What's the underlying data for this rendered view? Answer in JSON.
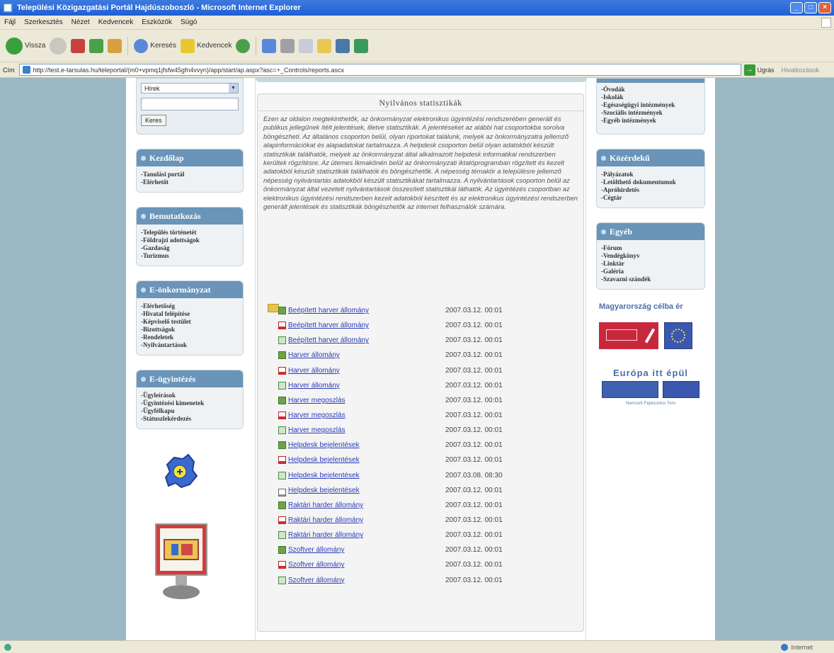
{
  "window": {
    "title": "Települési Közigazgatási Portál Hajdúszoboszló - Microsoft Internet Explorer",
    "btn_min": "_",
    "btn_max": "□",
    "btn_close": "×"
  },
  "menubar": {
    "items": [
      "Fájl",
      "Szerkesztés",
      "Nézet",
      "Kedvencek",
      "Eszközök",
      "Súgó"
    ]
  },
  "toolbar": {
    "back": "Vissza",
    "search": "Keresés",
    "favorites": "Kedvencek"
  },
  "address": {
    "label": "Cím",
    "url": "http://test.e-tarsulas.hu/teleportal/(m0+vpmq1jfsfw45gfn4vvyn)/app/start/ap.aspx?asc=+_Controls/reports.ascx",
    "go": "Ugrás",
    "links": "Hivatkozások"
  },
  "left": {
    "search": {
      "select_value": "Hírek",
      "button": "Keres"
    },
    "menus": [
      {
        "title": "Kezdőlap",
        "items": [
          "-Tanulási portál",
          "-Elérhetőt"
        ]
      },
      {
        "title": "Bemutatkozás",
        "items": [
          "-Település történetét",
          "-Földrajzi adottságok",
          "-Gazdaság",
          "-Turizmus"
        ]
      },
      {
        "title": "E-önkormányzat",
        "items": [
          "-Elérhetőség",
          "-Hivatal felépítése",
          "-Képviselő testület",
          "-Bizottságok",
          "-Rendeletek",
          "-Nyilvántartások"
        ]
      },
      {
        "title": "E-ügyintézés",
        "items": [
          "-Ügyleírások",
          "-Ügyintézési kimenetek",
          "-Ügyfélkapu",
          "-Státuszlekérdezés"
        ]
      }
    ]
  },
  "center": {
    "panel_title": "Nyilvános statisztikák",
    "intro": "Ezen az oldalon megtekinthetők, az önkormányzat elektronikus ügyintézési rendszerében generált és publikus jellegűnek ítélt jelentések, illetve statisztikák. A jelentéseket az alábbi hat csoportokba sorolva böngészheti. Az általános csoporton belül, olyan riportokat találunk, melyek az önkormányzatra jellemző alapinformációkat és alapadatokat tartalmazza. A helpdesk csoporton belül olyan adatokból készült statisztikák találhatók, melyek az önkormányzat által alkalmazott helpdesk informatikai rendszerben kerültek rögzítésre. Az ütemes Ikmakönén belül az önkormányzati iktatóprogramban rögzített és kezelt adatokból készült statisztikák találhatók és böngészhetők. A népesség témakör a településre jellemző népesség nyilvántartás adatokból készült statisztikákat tartalmazza. A nyilvántartások csoporton belül az önkormányzat által vezetett nyilvántartások összesített statisztikái láthatók. Az ügyintézés csoportban az elektronikus ügyintézési rendszerben kezelt adatokból készített és az elektronikus ügyintézési rendszerben generált jelentések és statisztikák böngészhetők az internet felhasználók számára.",
    "reports": [
      {
        "icon": "xls",
        "name": "Beépített harver állomány",
        "date": "2007.03.12. 00:01"
      },
      {
        "icon": "pdf",
        "name": "Beépített harver állomány",
        "date": "2007.03.12. 00:01"
      },
      {
        "icon": "csv",
        "name": "Beépített harver állomány",
        "date": "2007.03.12. 00:01"
      },
      {
        "icon": "xls",
        "name": "Harver állomány",
        "date": "2007.03.12. 00:01"
      },
      {
        "icon": "pdf",
        "name": "Harver állomány",
        "date": "2007.03.12. 00:01"
      },
      {
        "icon": "csv",
        "name": "Harver állomány",
        "date": "2007.03.12. 00:01"
      },
      {
        "icon": "xls",
        "name": "Harver megoszlás",
        "date": "2007.03.12. 00:01"
      },
      {
        "icon": "pdf",
        "name": "Harver megoszlás",
        "date": "2007.03.12. 00:01"
      },
      {
        "icon": "csv",
        "name": "Harver megoszlás",
        "date": "2007.03.12. 00:01"
      },
      {
        "icon": "xls",
        "name": "Helpdesk bejelentések",
        "date": "2007.03.12. 00:01"
      },
      {
        "icon": "pdf",
        "name": "Helpdesk bejelentések",
        "date": "2007.03.12. 00:01"
      },
      {
        "icon": "csv",
        "name": "Helpdesk bejelentések",
        "date": "2007.03.08. 08:30"
      },
      {
        "icon": "txt",
        "name": "Helpdesk bejelentések",
        "date": "2007.03.12. 00:01"
      },
      {
        "icon": "xls",
        "name": "Raktári harder állomány",
        "date": "2007.03.12. 00:01"
      },
      {
        "icon": "pdf",
        "name": "Raktári harder állomány",
        "date": "2007.03.12. 00:01"
      },
      {
        "icon": "csv",
        "name": "Raktári harder állomány",
        "date": "2007.03.12. 00:01"
      },
      {
        "icon": "xls",
        "name": "Szoftver állomány",
        "date": "2007.03.12. 00:01"
      },
      {
        "icon": "pdf",
        "name": "Szoftver állomány",
        "date": "2007.03.12. 00:01"
      },
      {
        "icon": "csv",
        "name": "Szoftver állomány",
        "date": "2007.03.12. 00:01"
      }
    ]
  },
  "right": {
    "top_items": [
      "-Óvodák",
      "-Iskolák",
      "-Egészségügyi intézmények",
      "-Szociális intézmények",
      "-Egyéb intézmények"
    ],
    "menus": [
      {
        "title": "Közérdekű",
        "items": [
          "-Pályázatok",
          "-Letölthető dokumentumok",
          "-Apróhirdetés",
          "-Cégtár"
        ]
      },
      {
        "title": "Egyéb",
        "items": [
          "-Fórum",
          "-Vendégkönyv",
          "-Linktár",
          "-Galéria",
          "-Szavazni szándék"
        ]
      }
    ],
    "mo_title": "Magyarország célba ér",
    "europa": "Európa itt épül",
    "nft": "Nemzeti Fejlesztési Terv"
  },
  "status": {
    "zone": "Internet"
  }
}
